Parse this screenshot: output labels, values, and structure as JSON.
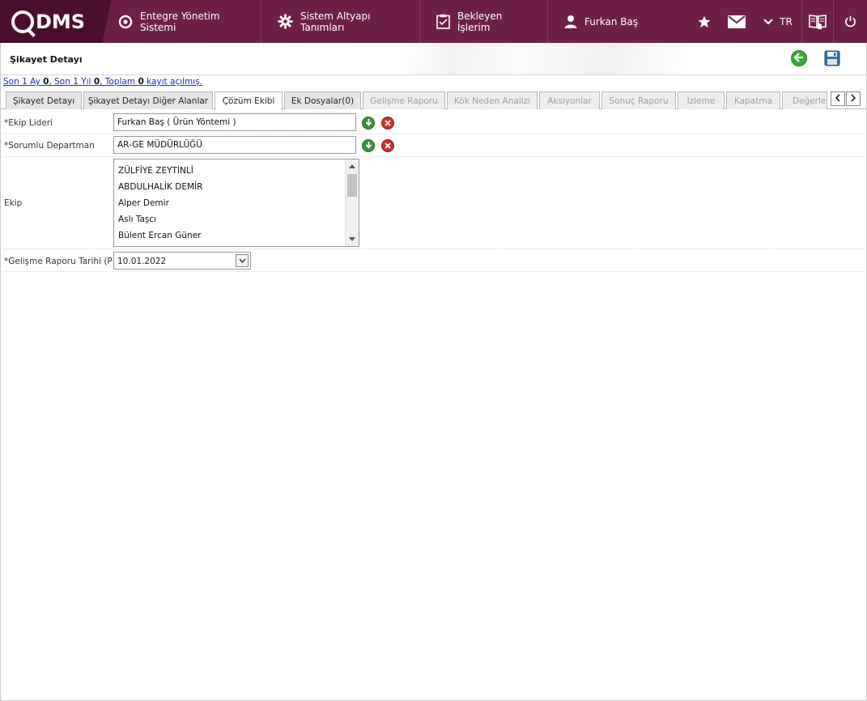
{
  "topbar": {
    "logo_text": "DMS",
    "nav": [
      {
        "label": "Entegre Yönetim Sistemi",
        "icon": "qdms-circle-icon"
      },
      {
        "label": "Sistem Altyapı Tanımları",
        "icon": "gear-icon"
      },
      {
        "label": "Bekleyen İşlerim",
        "icon": "clipboard-icon"
      },
      {
        "label": "Furkan Baş",
        "icon": "user-icon"
      }
    ],
    "lang": "TR",
    "colors": {
      "bar": "#6e1f47",
      "logo_bg": "#4a0f2e"
    }
  },
  "page": {
    "title": "Şikayet Detayı",
    "info_prefix": "Son 1 Ay ",
    "info_month": "0",
    "info_mid": ", Son 1 Yıl ",
    "info_year": "0",
    "info_mid2": ", Toplam ",
    "info_total": "0",
    "info_suffix": " kayıt açılmış."
  },
  "tabs": [
    {
      "label": "Şikayet Detayı",
      "state": "normal"
    },
    {
      "label": "Şikayet Detayı Diğer Alanlar",
      "state": "normal"
    },
    {
      "label": "Çözüm Ekibi",
      "state": "active"
    },
    {
      "label": "Ek Dosyalar(0)",
      "state": "normal"
    },
    {
      "label": "Gelişme Raporu",
      "state": "disabled"
    },
    {
      "label": "Kök Neden Analizi",
      "state": "disabled"
    },
    {
      "label": "Aksiyonlar",
      "state": "disabled"
    },
    {
      "label": "Sonuç Raporu",
      "state": "disabled"
    },
    {
      "label": "İzleme",
      "state": "disabled"
    },
    {
      "label": "Kapatma",
      "state": "disabled"
    },
    {
      "label": "Değerlen",
      "state": "disabled"
    }
  ],
  "form": {
    "ekip_lideri_label": "*Ekip Lideri",
    "ekip_lideri_value": "Furkan Baş ( Ürün Yöntemi )",
    "sorumlu_label": "*Sorumlu Departman",
    "sorumlu_value": "AR-GE MÜDÜRLÜĞÜ",
    "ekip_label": "Ekip",
    "ekip_members": [
      "ZÜLFİYE ZEYTİNLİ",
      "ABDULHALİK DEMİR",
      "Alper Demir",
      "Aslı Taşcı",
      "Bülent Ercan Güner"
    ],
    "rapor_tarihi_label": "*Gelişme Raporu Tarihi (P)",
    "rapor_tarihi_value": "10.01.2022"
  }
}
